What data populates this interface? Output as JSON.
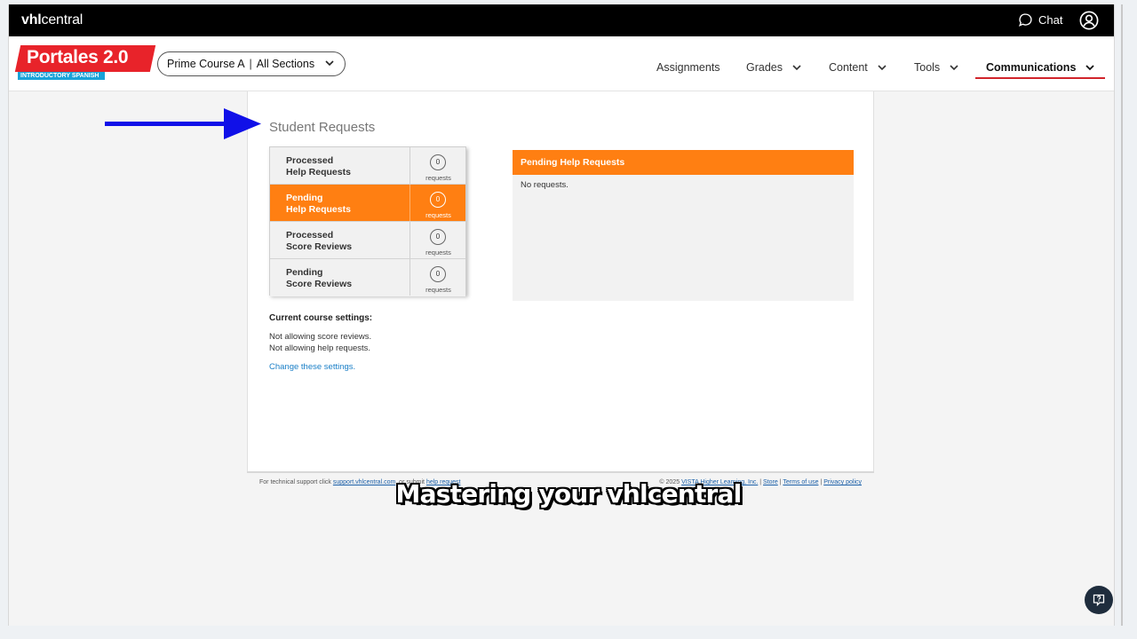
{
  "topbar": {
    "brand_prefix": "vhl",
    "brand_suffix": "central",
    "chat_label": "Chat",
    "chat_icon": "chat-bubble-icon",
    "user_icon": "user-account-icon"
  },
  "logo": {
    "title": "Portales 2.0",
    "subtitle": "INTRODUCTORY SPANISH"
  },
  "course_selector": {
    "course": "Prime Course A",
    "sections": "All Sections"
  },
  "nav": {
    "items": [
      {
        "label": "Assignments"
      },
      {
        "label": "Grades"
      },
      {
        "label": "Content"
      },
      {
        "label": "Tools"
      },
      {
        "label": "Communications"
      }
    ],
    "active": "Communications"
  },
  "page": {
    "title": "Student Requests"
  },
  "requests": [
    {
      "line1": "Processed",
      "line2": "Help Requests",
      "count": "0",
      "unit": "requests",
      "active": false
    },
    {
      "line1": "Pending",
      "line2": "Help Requests",
      "count": "0",
      "unit": "requests",
      "active": true
    },
    {
      "line1": "Processed",
      "line2": "Score Reviews",
      "count": "0",
      "unit": "requests",
      "active": false
    },
    {
      "line1": "Pending",
      "line2": "Score Reviews",
      "count": "0",
      "unit": "requests",
      "active": false
    }
  ],
  "pending_panel": {
    "header": "Pending Help Requests",
    "body": "No requests."
  },
  "settings": {
    "heading": "Current course settings:",
    "line1": "Not allowing score reviews.",
    "line2": "Not allowing help requests.",
    "link": "Change these settings."
  },
  "footer": {
    "left_text": "For technical support click",
    "support_link": "support.vhlcentral.com",
    "left_mid": ", or submit",
    "help_link": "help request",
    "copyright": "© 2025",
    "company_link": "VISTA Higher Learning, Inc.",
    "store_link": "Store",
    "terms_link": "Terms of use",
    "privacy_link": "Privacy policy",
    "divider": "|"
  },
  "caption": "Mastering your vhlcentral",
  "colors": {
    "accent_orange": "#ff7f12",
    "nav_underline": "#d1242b",
    "arrow_blue": "#1010e8",
    "link_blue": "#1a7fc7"
  }
}
